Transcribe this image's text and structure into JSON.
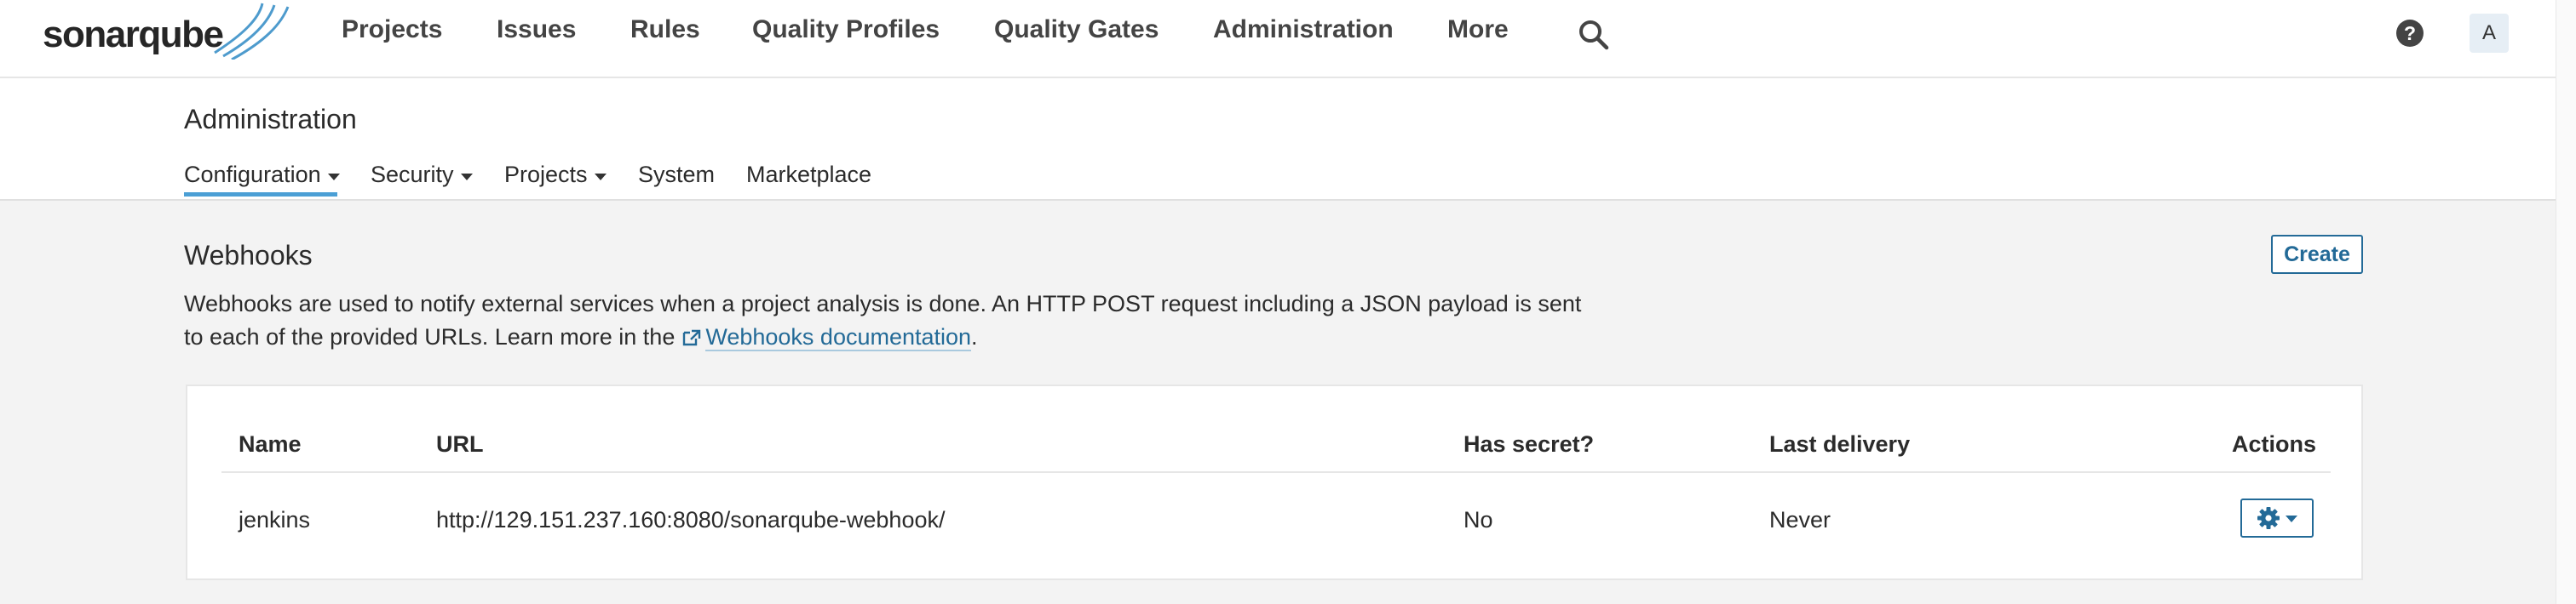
{
  "logo": {
    "text": "sonarqube"
  },
  "topnav": {
    "items": [
      "Projects",
      "Issues",
      "Rules",
      "Quality Profiles",
      "Quality Gates",
      "Administration",
      "More"
    ],
    "search_icon": "search-icon",
    "help_icon": "help-icon",
    "avatar_letter": "A"
  },
  "admin": {
    "title": "Administration",
    "tabs": [
      {
        "label": "Configuration",
        "dropdown": true,
        "active": true
      },
      {
        "label": "Security",
        "dropdown": true,
        "active": false
      },
      {
        "label": "Projects",
        "dropdown": true,
        "active": false
      },
      {
        "label": "System",
        "dropdown": false,
        "active": false
      },
      {
        "label": "Marketplace",
        "dropdown": false,
        "active": false
      }
    ]
  },
  "webhooks": {
    "title": "Webhooks",
    "create_label": "Create",
    "description_line1": "Webhooks are used to notify external services when a project analysis is done. An HTTP POST request including a JSON payload is sent",
    "description_line2_prefix": "to each of the provided URLs. Learn more in the",
    "doc_link_text": "Webhooks documentation",
    "description_suffix": ".",
    "table": {
      "headers": [
        "Name",
        "URL",
        "Has secret?",
        "Last delivery",
        "Actions"
      ],
      "rows": [
        {
          "name": "jenkins",
          "url": "http://129.151.237.160:8080/sonarqube-webhook/",
          "has_secret": "No",
          "last_delivery": "Never"
        }
      ]
    }
  },
  "colors": {
    "accent": "#236a97",
    "tab_underline": "#4b9fd5",
    "page_bg": "#f3f3f3"
  }
}
